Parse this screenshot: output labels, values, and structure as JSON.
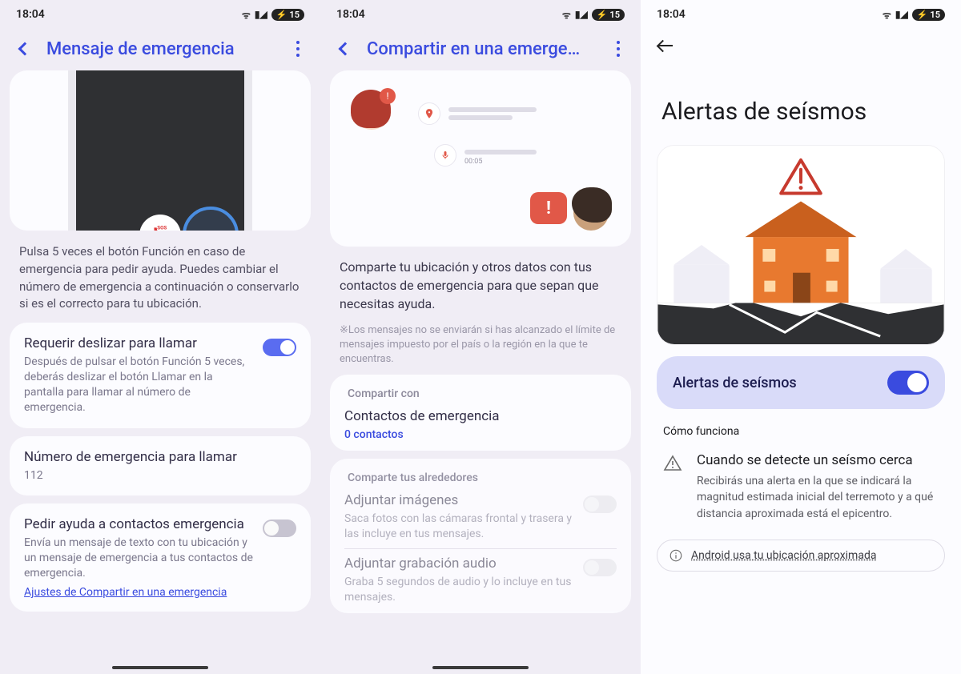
{
  "status": {
    "time": "18:04",
    "battery": "15"
  },
  "p1": {
    "title": "Mensaje de emergencia",
    "desc": "Pulsa 5 veces el botón Función en caso de emergencia para pedir ayuda. Puedes cambiar el número de emergencia a continuación o conservarlo si es el correcto para tu ubicación.",
    "s1_title": "Requerir deslizar para llamar",
    "s1_sub": "Después de pulsar el botón Función 5 veces, deberás deslizar el botón Llamar en la pantalla para llamar al número de emergencia.",
    "s2_title": "Número de emergencia para llamar",
    "s2_sub": "112",
    "s3_title": "Pedir ayuda a contactos emergencia",
    "s3_sub": "Envía un mensaje de texto con tu ubicación y un mensaje de emergencia a tus contactos de emergencia.",
    "s3_link": "Ajustes de Compartir en una emergencia",
    "sos": "SOS"
  },
  "p2": {
    "title": "Compartir en una emerge…",
    "desc": "Comparte tu ubicación y otros datos con tus contactos de emergencia para que sepan que necesitas ayuda.",
    "note": "※Los mensajes no se enviarán si has alcanzado el límite de mensajes impuesto por el país o la región en la que te encuentras.",
    "sec1": "Compartir con",
    "contacts_title": "Contactos de emergencia",
    "contacts_sub": "0 contactos",
    "sec2": "Comparte tus alrededores",
    "img_title": "Adjuntar imágenes",
    "img_sub": "Saca fotos con las cámaras frontal y trasera y las incluye en tus mensajes.",
    "aud_title": "Adjuntar grabación audio",
    "aud_sub": "Graba 5 segundos de audio y lo incluye en tus mensajes.",
    "audio_time": "00:05"
  },
  "p3": {
    "title": "Alertas de seísmos",
    "toggle_label": "Alertas de seísmos",
    "how": "Cómo funciona",
    "info_title": "Cuando se detecte un seísmo cerca",
    "info_desc": "Recibirás una alerta en la que se indicará la magnitud estimada inicial del terremoto y a qué distancia aproximada está el epicentro.",
    "chip": "Android usa tu ubicación aproximada"
  }
}
